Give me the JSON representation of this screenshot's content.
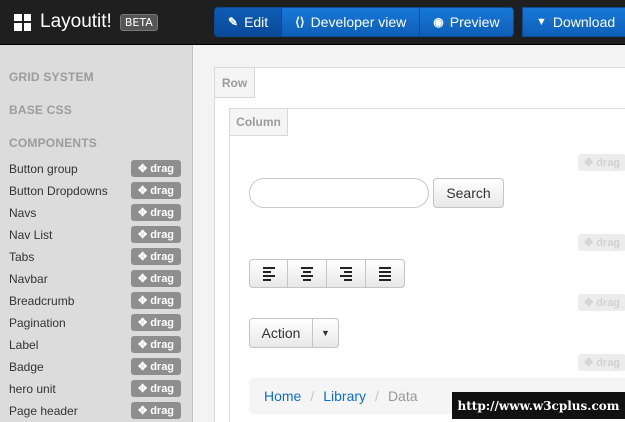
{
  "app": {
    "name": "Layoutit!",
    "badge": "BETA"
  },
  "toolbar": {
    "edit": "Edit",
    "developer_view": "Developer view",
    "preview": "Preview",
    "download": "Download"
  },
  "sidebar": {
    "sections": [
      "GRID SYSTEM",
      "BASE CSS",
      "COMPONENTS"
    ],
    "drag_label": "drag",
    "components": [
      "Button group",
      "Button Dropdowns",
      "Navs",
      "Nav List",
      "Tabs",
      "Navbar",
      "Breadcrumb",
      "Pagination",
      "Label",
      "Badge",
      "hero unit",
      "Page header"
    ]
  },
  "canvas": {
    "row_tab": "Row",
    "column_tab": "Column",
    "drag_label": "drag",
    "search_button": "Search",
    "action_button": "Action",
    "breadcrumb": {
      "home": "Home",
      "library": "Library",
      "data": "Data",
      "separator": "/"
    }
  },
  "watermark": "http://www.w3cplus.com",
  "colors": {
    "topbar": "#1f1f1f",
    "primary": "#0f5fb8",
    "sidebar": "#dcdcdc",
    "drag_badge": "#8e8e8e",
    "link": "#0e6ec6"
  }
}
